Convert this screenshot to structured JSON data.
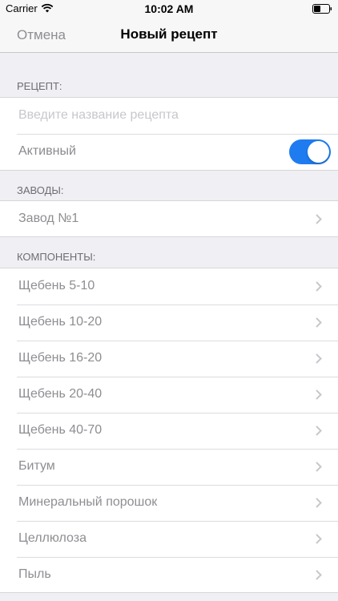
{
  "status_bar": {
    "carrier": "Carrier",
    "time": "10:02 AM"
  },
  "nav": {
    "cancel_label": "Отмена",
    "title": "Новый рецепт"
  },
  "recipe_section": {
    "header": "РЕЦЕПТ:",
    "name_placeholder": "Введите название рецепта",
    "name_value": "",
    "active_label": "Активный",
    "active_on": true
  },
  "plants_section": {
    "header": "ЗАВОДЫ:",
    "items": [
      {
        "label": "Завод №1"
      }
    ]
  },
  "components_section": {
    "header": "КОМПОНЕНТЫ:",
    "items": [
      {
        "label": "Щебень 5-10"
      },
      {
        "label": "Щебень 10-20"
      },
      {
        "label": "Щебень 16-20"
      },
      {
        "label": "Щебень 20-40"
      },
      {
        "label": "Щебень 40-70"
      },
      {
        "label": "Битум"
      },
      {
        "label": "Минеральный порошок"
      },
      {
        "label": "Целлюлоза"
      },
      {
        "label": "Пыль"
      }
    ]
  },
  "colors": {
    "accent": "#1e7cf0",
    "background": "#efeff4",
    "secondary_text": "#8e8e93"
  },
  "icons": {
    "status": [
      "wifi-icon",
      "battery-icon"
    ],
    "disclosure": "chevron-right-icon"
  }
}
